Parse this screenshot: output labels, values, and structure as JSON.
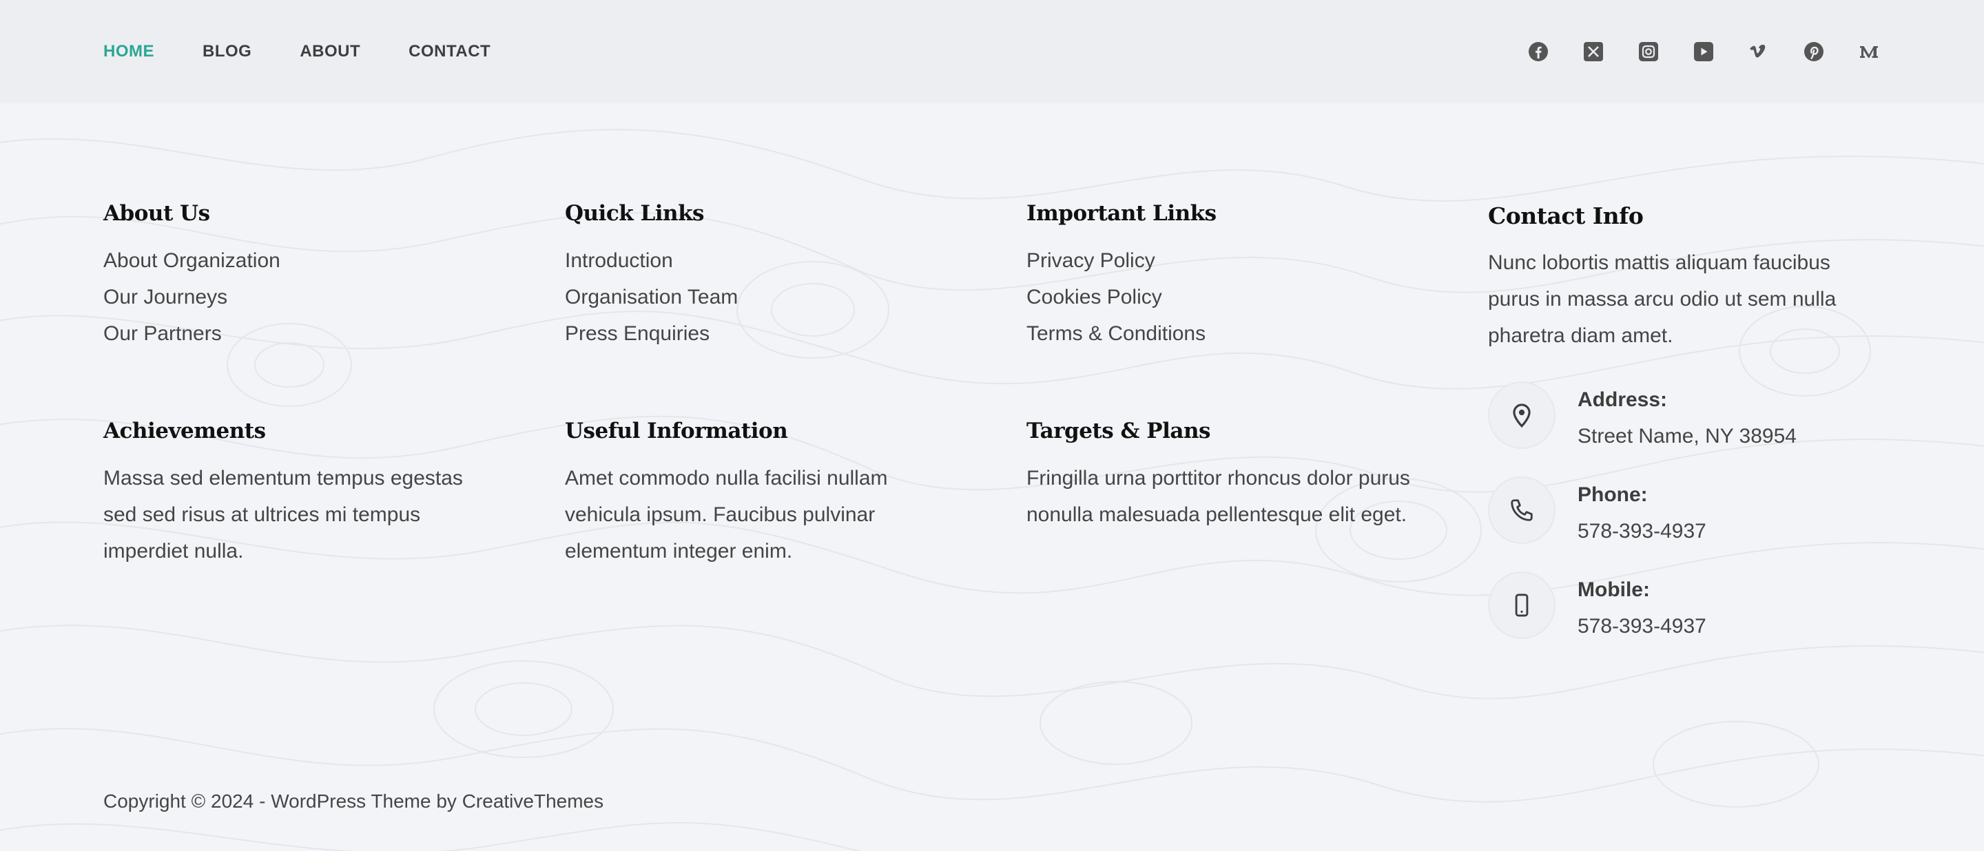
{
  "nav": {
    "items": [
      {
        "label": "HOME",
        "active": true
      },
      {
        "label": "BLOG",
        "active": false
      },
      {
        "label": "ABOUT",
        "active": false
      },
      {
        "label": "CONTACT",
        "active": false
      }
    ],
    "active_color": "#2aa893"
  },
  "socials": [
    "facebook-icon",
    "x-twitter-icon",
    "instagram-icon",
    "youtube-icon",
    "vimeo-icon",
    "pinterest-icon",
    "medium-icon"
  ],
  "columns": {
    "about": {
      "title": "About Us",
      "links": [
        "About Organization",
        "Our Journeys",
        "Our Partners"
      ]
    },
    "quick": {
      "title": "Quick Links",
      "links": [
        "Introduction",
        "Organisation Team",
        "Press Enquiries"
      ]
    },
    "important": {
      "title": "Important Links",
      "links": [
        "Privacy Policy",
        "Cookies Policy",
        "Terms & Conditions"
      ]
    },
    "achievements": {
      "title": "Achievements",
      "text": "Massa sed elementum tempus egestas sed sed risus at ultrices mi tempus imperdiet nulla."
    },
    "useful": {
      "title": "Useful Information",
      "text": "Amet commodo nulla facilisi nullam vehicula ipsum. Faucibus pulvinar elementum integer enim."
    },
    "targets": {
      "title": "Targets & Plans",
      "text": "Fringilla urna porttitor rhoncus dolor purus nonulla malesuada pellentesque elit eget."
    },
    "contact": {
      "title": "Contact Info",
      "text": "Nunc lobortis mattis aliquam faucibus purus in massa arcu odio ut sem nulla pharetra diam amet.",
      "items": [
        {
          "icon": "location-pin-icon",
          "label": "Address:",
          "value": "Street Name, NY 38954"
        },
        {
          "icon": "phone-icon",
          "label": "Phone:",
          "value": "578-393-4937"
        },
        {
          "icon": "mobile-icon",
          "label": "Mobile:",
          "value": "578-393-4937"
        }
      ]
    }
  },
  "copyright": "Copyright © 2024 - WordPress Theme by CreativeThemes"
}
